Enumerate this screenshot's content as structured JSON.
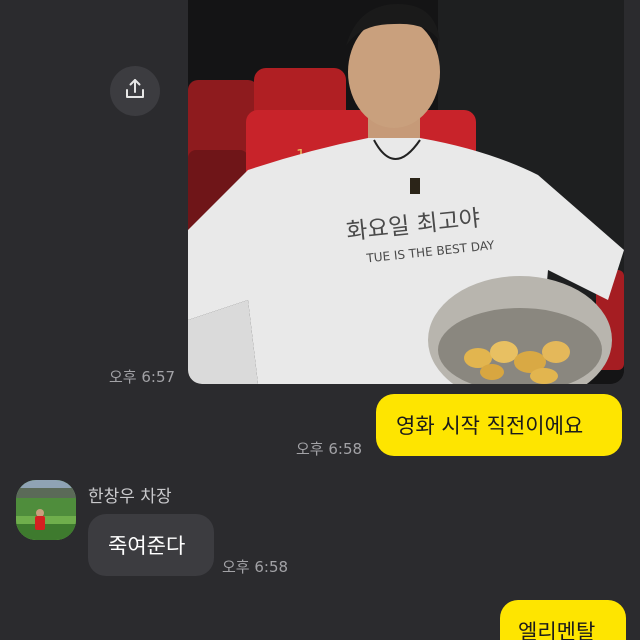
{
  "messages": {
    "photo": {
      "time": "오후 6:57",
      "shirt_text_korean": "화요일 최고야",
      "shirt_text_english": "TUE IS THE BEST DAY",
      "seat_number": "1"
    },
    "outgoing_1": {
      "text": "영화 시작 직전이에요",
      "time": "오후 6:58"
    },
    "incoming_1": {
      "sender": "한창우 차장",
      "text": "죽여준다",
      "time": "오후 6:58"
    },
    "outgoing_2": {
      "text": "엘리멘탈"
    }
  },
  "icons": {
    "share": "share-icon",
    "avatar": "avatar"
  },
  "colors": {
    "background": "#2b2b2e",
    "outgoing_bubble": "#fee500",
    "incoming_bubble": "#3c3c40",
    "timestamp": "#a2a2a6"
  }
}
